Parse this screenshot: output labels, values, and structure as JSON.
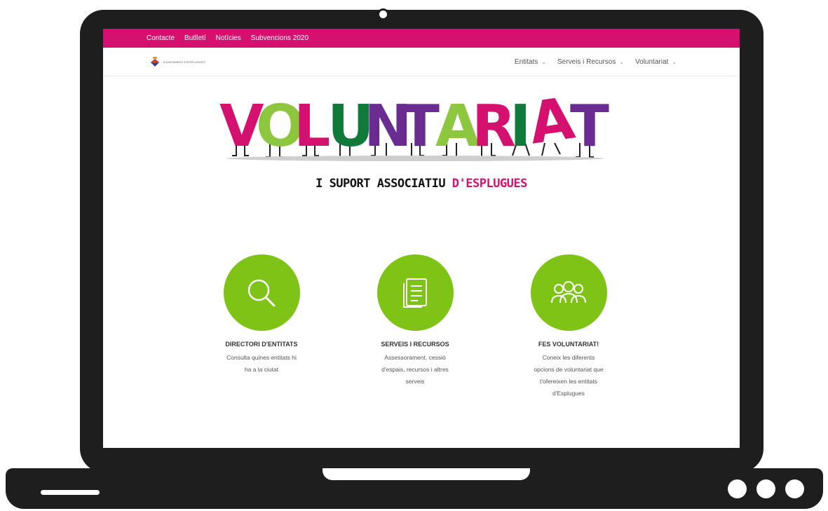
{
  "topbar": {
    "links": [
      "Contacte",
      "Butlletí",
      "Notícies",
      "Subvencions 2020"
    ]
  },
  "header": {
    "logo_text": "AJUNTAMENT D'ESPLUGUES",
    "menu": [
      {
        "label": "Entitats",
        "icon": "chevron-down-icon"
      },
      {
        "label": "Serveis i Recursos",
        "icon": "chevron-down-icon"
      },
      {
        "label": "Voluntariat",
        "icon": "chevron-down-icon"
      }
    ]
  },
  "hero": {
    "title": "VOLUNTARIAT",
    "subtitle_part1": "I SUPORT ASSOCIATIU ",
    "subtitle_part2": "D'ESPLUGUES"
  },
  "features": [
    {
      "icon": "search-icon",
      "title": "DIRECTORI D'ENTITATS",
      "desc": "Consulta quines entitats hi ha a la ciutat"
    },
    {
      "icon": "document-icon",
      "title": "SERVEIS I RECURSOS",
      "desc": "Assessorament, cessió d'espais, recursos i altres serveis"
    },
    {
      "icon": "people-icon",
      "title": "FES VOLUNTARIAT!",
      "desc": "Coneix les diferents opcions de voluntariat que t'ofereixen les entitats d'Esplugues"
    }
  ],
  "colors": {
    "brand_pink": "#d5116f",
    "accent_green": "#7ec316",
    "frame": "#1e1e1e"
  }
}
